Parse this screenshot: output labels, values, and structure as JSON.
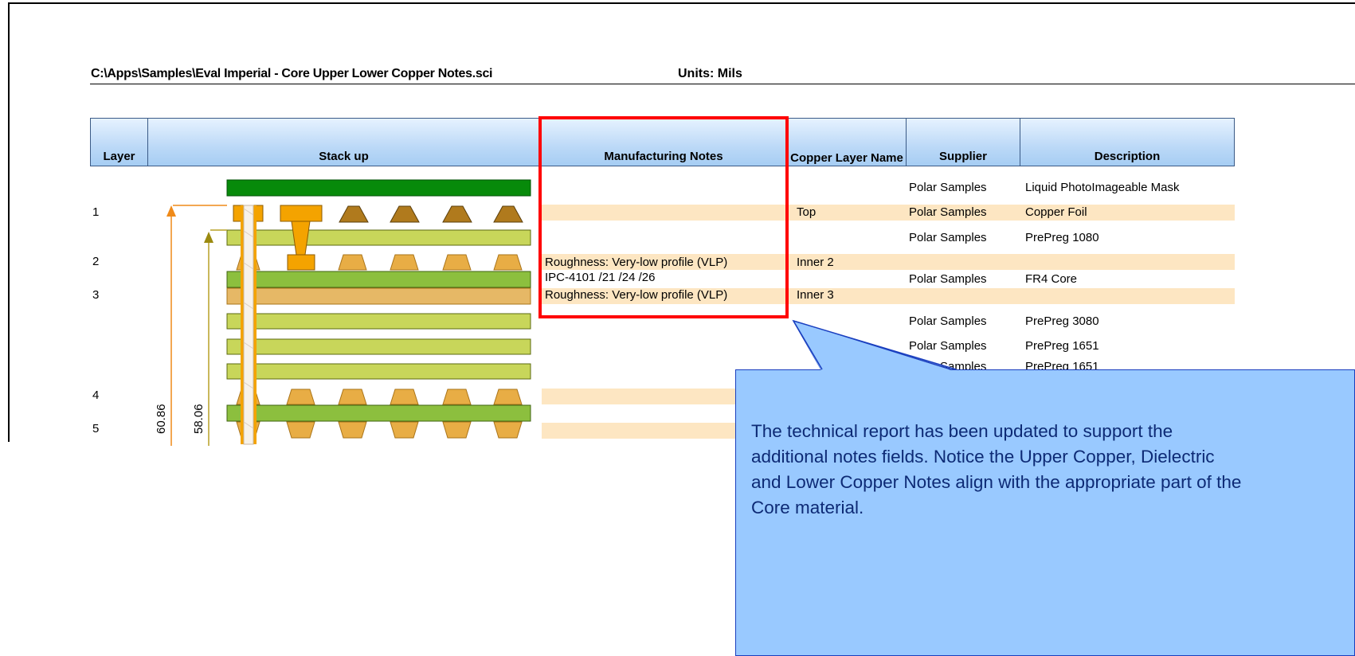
{
  "report": {
    "file_path": "C:\\Apps\\Samples\\Eval Imperial - Core Upper Lower Copper Notes.sci",
    "units": "Units: Mils"
  },
  "columns": {
    "layer": "Layer",
    "stackup": "Stack up",
    "manufacturing_notes": "Manufacturing Notes",
    "copper_layer_name": "Copper Layer Name",
    "supplier": "Supplier",
    "description": "Description"
  },
  "layers": [
    "1",
    "2",
    "3",
    "4",
    "5"
  ],
  "rows": [
    {
      "note": "",
      "copper": "",
      "supplier": "Polar Samples",
      "description": "Liquid PhotoImageable Mask"
    },
    {
      "note": "",
      "copper": "Top",
      "supplier": "Polar Samples",
      "description": "Copper Foil"
    },
    {
      "note": "",
      "copper": "",
      "supplier": "Polar Samples",
      "description": "PrePreg 1080"
    },
    {
      "note": "Roughness: Very-low profile (VLP)",
      "copper": "Inner 2",
      "supplier": "",
      "description": ""
    },
    {
      "note": "IPC-4101 /21 /24 /26",
      "copper": "",
      "supplier": "Polar Samples",
      "description": "FR4 Core"
    },
    {
      "note": "Roughness: Very-low profile (VLP)",
      "copper": "Inner 3",
      "supplier": "",
      "description": ""
    },
    {
      "note": "",
      "copper": "",
      "supplier": "Polar Samples",
      "description": "PrePreg 3080"
    },
    {
      "note": "",
      "copper": "",
      "supplier": "Polar Samples",
      "description": "PrePreg 1651"
    },
    {
      "note": "",
      "copper": "",
      "supplier": "Samples",
      "description": "PrePreg 1651"
    }
  ],
  "dimensions": {
    "outer": "60.86",
    "inner": "58.06"
  },
  "callout": {
    "text": "The technical report has been updated to support the additional notes fields.  Notice the Upper Copper, Dielectric and Lower Copper Notes align with the appropriate part of the Core material."
  },
  "colors": {
    "highlight_border": "#ff0000",
    "callout_fill": "#99c9ff",
    "callout_border": "#1a3fbf",
    "row_highlight": "#fde6c2",
    "mask": "#078a0a",
    "prepreg": "#c8d65a",
    "core": "#8cbf3e",
    "copper_top": "#b07a1d",
    "copper_inner": "#e8ad45",
    "via": "#f4a300"
  }
}
